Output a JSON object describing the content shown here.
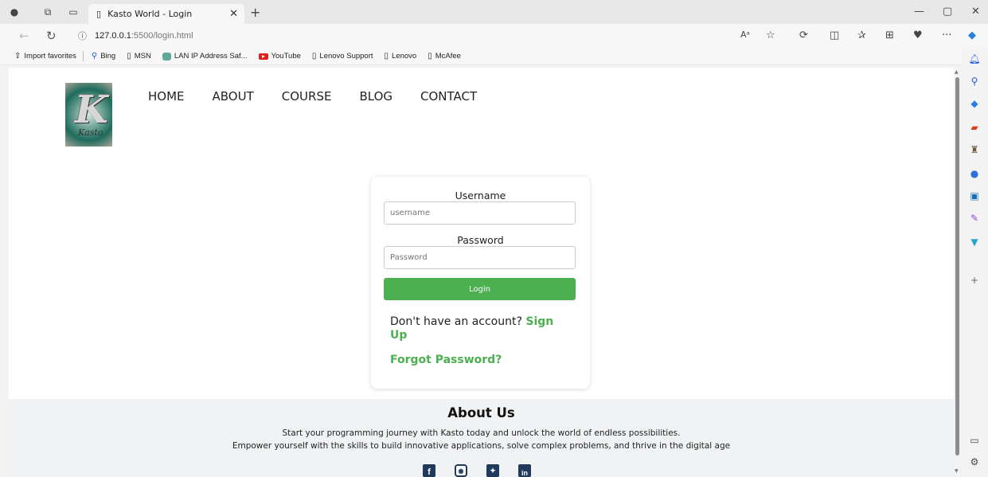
{
  "browser": {
    "tab_title": "Kasto World - Login",
    "url_host": "127.0.0.1",
    "url_path": ":5500/login.html",
    "favorites": [
      {
        "label": "Import favorites"
      },
      {
        "label": "Bing"
      },
      {
        "label": "MSN"
      },
      {
        "label": "LAN IP Address Saf..."
      },
      {
        "label": "YouTube"
      },
      {
        "label": "Lenovo Support"
      },
      {
        "label": "Lenovo"
      },
      {
        "label": "McAfee"
      }
    ]
  },
  "site": {
    "logo_letter": "K",
    "logo_signature": "Kasto",
    "nav": [
      "HOME",
      "ABOUT",
      "COURSE",
      "BLOG",
      "CONTACT"
    ]
  },
  "login": {
    "username_label": "Username",
    "username_placeholder": "username",
    "password_label": "Password",
    "password_placeholder": "Password",
    "login_button": "Login",
    "signup_prompt": "Don't have an account? ",
    "signup_link": "Sign Up",
    "forgot_link": "Forgot Password?"
  },
  "footer": {
    "title": "About Us",
    "line1": "Start your programming journey with Kasto today and unlock the world of endless possibilities.",
    "line2": "Empower yourself with the skills to build innovative applications, solve complex problems, and thrive in the digital age",
    "social": [
      "facebook-icon",
      "instagram-icon",
      "twitter-icon",
      "linkedin-icon"
    ]
  },
  "colors": {
    "accent": "#4caf50",
    "footer_bg": "#f0f2f4"
  }
}
